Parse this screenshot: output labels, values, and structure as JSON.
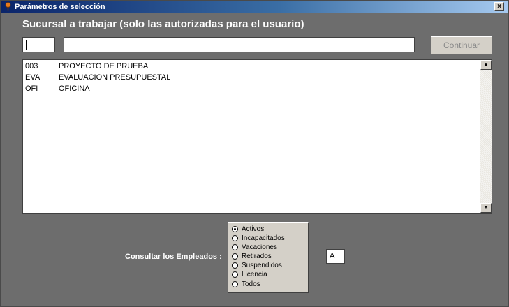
{
  "window": {
    "title": "Parámetros de selección",
    "close_glyph": "×"
  },
  "header": {
    "heading": "Sucursal  a trabajar (solo las autorizadas para el usuario)"
  },
  "form": {
    "code_value": "",
    "name_value": "",
    "continue_label": "Continuar"
  },
  "list": {
    "rows": [
      {
        "code": "003",
        "name": "PROYECTO DE PRUEBA"
      },
      {
        "code": "EVA",
        "name": "EVALUACION PRESUPUESTAL"
      },
      {
        "code": "OFI",
        "name": "OFICINA"
      }
    ],
    "scroll_up": "▲",
    "scroll_down": "▼"
  },
  "filter": {
    "label": "Consultar los Empleados :",
    "options": [
      "Activos",
      "Incapacitados",
      "Vacaciones",
      "Retirados",
      "Suspendidos",
      "Licencia",
      "Todos"
    ],
    "selected": "Activos",
    "status_value": "A"
  },
  "colors": {
    "background": "#6d6d6d",
    "titlebar": "#0a246a",
    "panel": "#d4d0c8"
  }
}
